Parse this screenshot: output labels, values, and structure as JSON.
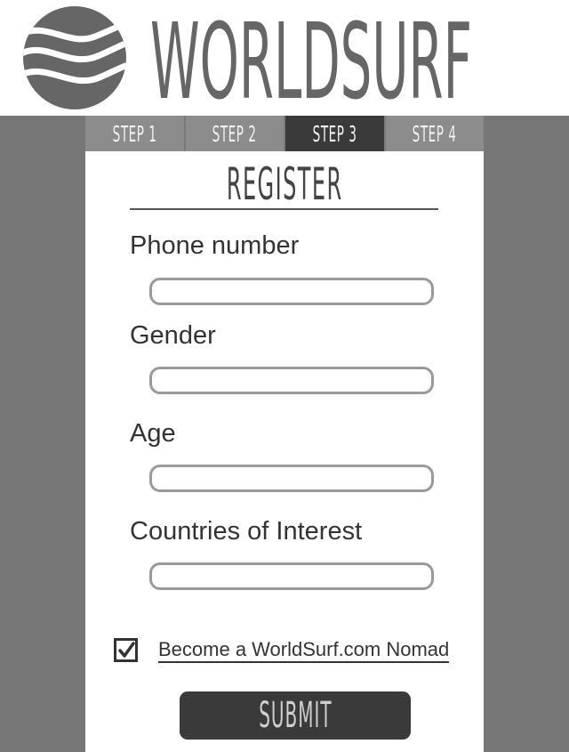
{
  "brand": {
    "name": "WORLDSURF",
    "logo_icon": "wave-globe-icon"
  },
  "tabs": [
    {
      "label": "STEP 1",
      "active": false
    },
    {
      "label": "STEP 2",
      "active": false
    },
    {
      "label": "STEP 3",
      "active": true
    },
    {
      "label": "STEP 4",
      "active": false
    }
  ],
  "form": {
    "title": "REGISTER",
    "fields": [
      {
        "label": "Phone number",
        "value": ""
      },
      {
        "label": "Gender",
        "value": ""
      },
      {
        "label": "Age",
        "value": ""
      },
      {
        "label": "Countries of Interest",
        "value": ""
      }
    ],
    "nomad": {
      "checked": true,
      "label": "Become a WorldSurf.com Nomad"
    },
    "submit_label": "SUBMIT"
  },
  "colors": {
    "background": "#777777",
    "active_tab": "#3a3a3a",
    "tab": "#8c8c8c",
    "button": "#3a3a3a"
  }
}
